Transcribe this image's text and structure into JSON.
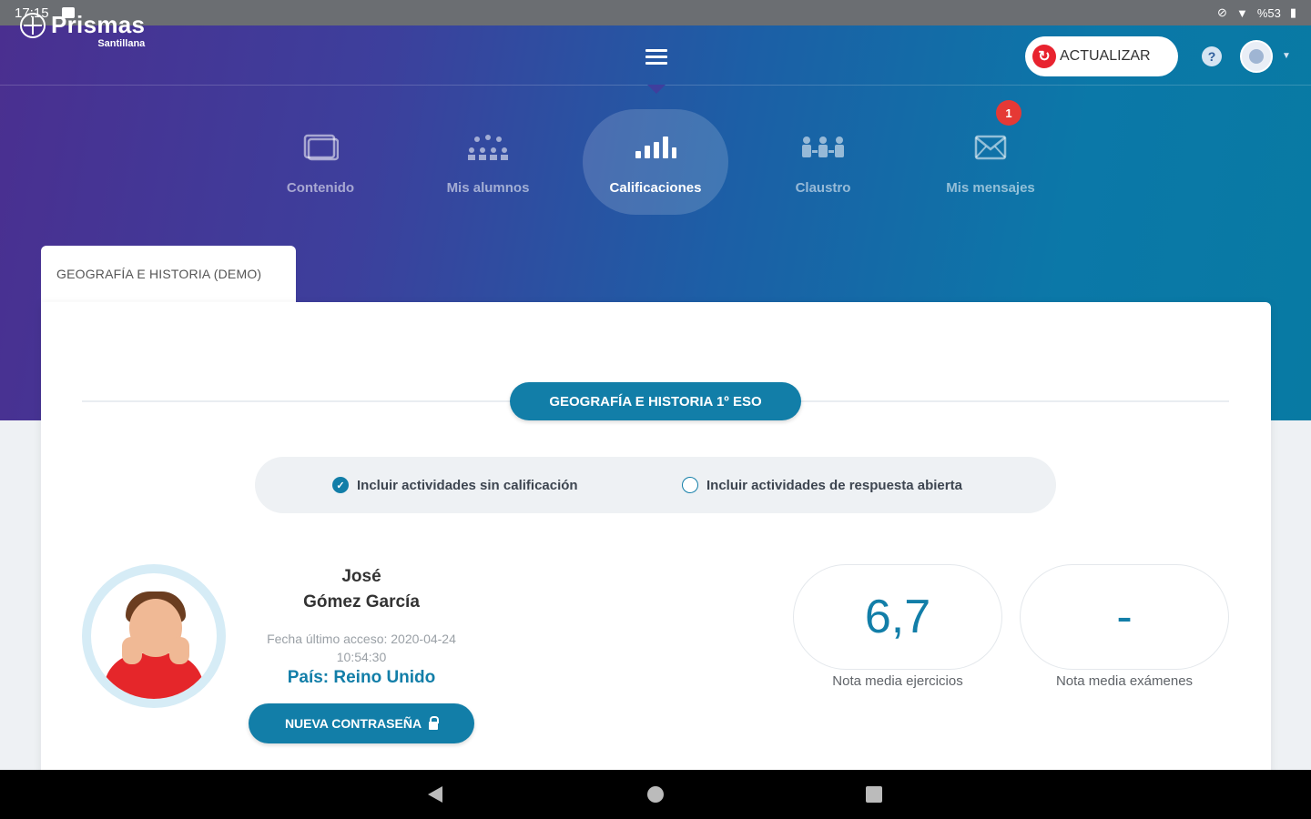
{
  "status_bar": {
    "time": "17:15",
    "battery": "%53"
  },
  "brand": {
    "name": "Prismas",
    "sub": "Santillana"
  },
  "header": {
    "update_label": "ACTUALIZAR",
    "help_glyph": "?"
  },
  "nav": [
    {
      "label": "Contenido",
      "icon": "content-icon"
    },
    {
      "label": "Mis alumnos",
      "icon": "students-icon"
    },
    {
      "label": "Calificaciones",
      "icon": "grades-icon",
      "active": true
    },
    {
      "label": "Claustro",
      "icon": "faculty-icon"
    },
    {
      "label": "Mis mensajes",
      "icon": "mail-icon",
      "badge": "1"
    }
  ],
  "subject_tab": "GEOGRAFÍA E HISTORIA (DEMO)",
  "course": "GEOGRAFÍA E HISTORIA 1º ESO",
  "filters": [
    {
      "label": "Incluir actividades sin calificación",
      "checked": true
    },
    {
      "label": "Incluir actividades de respuesta abierta",
      "checked": false
    }
  ],
  "student": {
    "first_name": "José",
    "last_name": "Gómez García",
    "last_access": "Fecha último acceso: 2020-04-24",
    "last_access_time": "10:54:30",
    "country": "País: Reino Unido",
    "password_button": "NUEVA CONTRASEÑA"
  },
  "scores": [
    {
      "value": "6,7",
      "label": "Nota media ejercicios"
    },
    {
      "value": "-",
      "label": "Nota media exámenes"
    }
  ],
  "colors": {
    "accent": "#127ea8",
    "badge": "#e53935",
    "update": "#e8232f"
  }
}
